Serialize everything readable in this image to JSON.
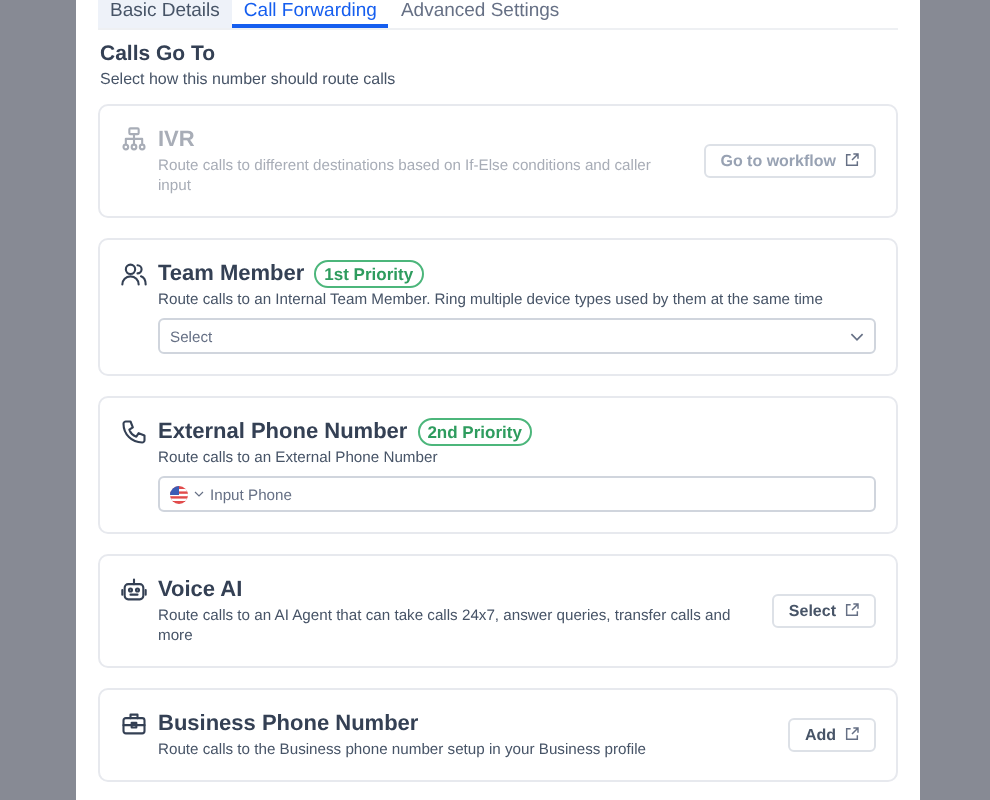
{
  "tabs": [
    {
      "label": "Basic Details",
      "selected": false
    },
    {
      "label": "Call Forwarding",
      "selected": true
    },
    {
      "label": "Advanced Settings",
      "selected": false
    }
  ],
  "section": {
    "title": "Calls Go To",
    "subtitle": "Select how this number should route calls"
  },
  "options": [
    {
      "kind": "button",
      "title": "IVR",
      "description": "Route calls to different destinations based on If-Else conditions and caller input",
      "disabled": true,
      "action": "Go to workflow"
    },
    {
      "kind": "select",
      "title": "Team Member",
      "badge": "1st Priority",
      "description": "Route calls to an Internal Team Member. Ring multiple device types used by them at the same time",
      "disabled": false,
      "placeholder": "Select"
    },
    {
      "kind": "phone",
      "title": "External Phone Number",
      "badge": "2nd Priority",
      "description": "Route calls to an External Phone Number",
      "disabled": false,
      "placeholder": "Input Phone"
    },
    {
      "kind": "button",
      "title": "Voice AI",
      "description": "Route calls to an AI Agent that can take calls 24x7, answer queries, transfer calls and more",
      "disabled": false,
      "action": "Select"
    },
    {
      "kind": "button",
      "title": "Business Phone Number",
      "description": "Route calls to the Business phone number setup in your Business profile",
      "disabled": false,
      "action": "Add"
    }
  ]
}
